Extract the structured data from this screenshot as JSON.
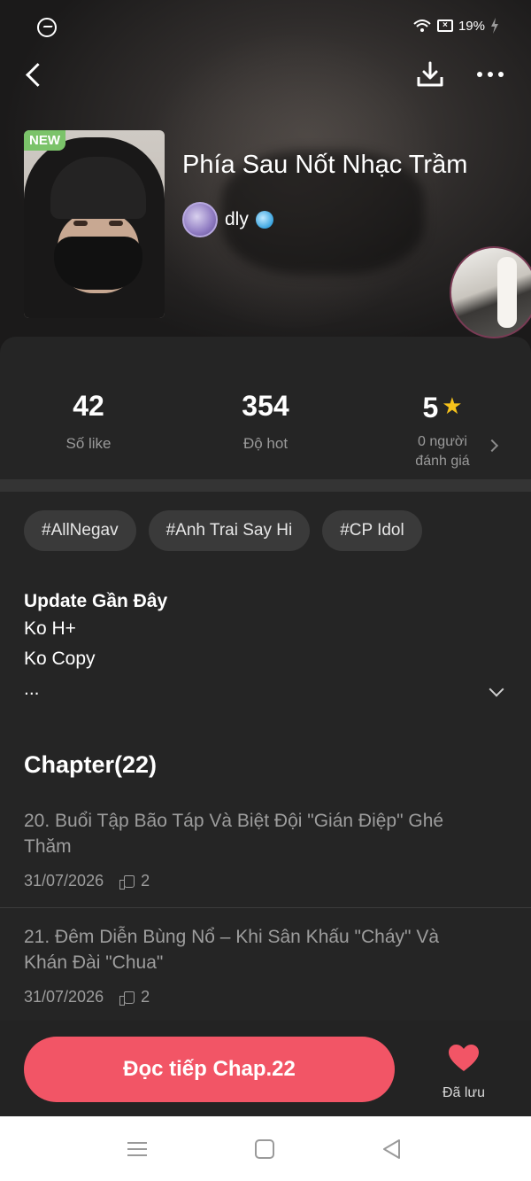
{
  "status_bar": {
    "battery": "19%"
  },
  "story": {
    "badge": "NEW",
    "title": "Phía Sau Nốt Nhạc Trầm",
    "author": "dly"
  },
  "stats": {
    "likes_value": "42",
    "likes_label": "Số like",
    "hot_value": "354",
    "hot_label": "Độ hot",
    "rating_value": "5",
    "rating_label_1": "0 người",
    "rating_label_2": "đánh giá"
  },
  "tags": [
    "#AllNegav",
    "#Anh Trai Say Hi",
    "#CP Idol"
  ],
  "description": {
    "title": "Update Gần Đây",
    "lines": [
      "Ko H+",
      "Ko Copy",
      "..."
    ]
  },
  "chapters": {
    "heading": "Chapter(22)",
    "items": [
      {
        "title": "20. Buổi Tập Bão Táp Và Biệt Đội \"Gián Điệp\" Ghé Thăm",
        "date": "31/07/2026",
        "likes": "2"
      },
      {
        "title": "21. Đêm Diễn Bùng Nổ – Khi Sân Khấu \"Cháy\" Và Khán Đài \"Chua\"",
        "date": "31/07/2026",
        "likes": "2"
      }
    ]
  },
  "actions": {
    "continue_label": "Đọc tiếp Chap.22",
    "saved_label": "Đã lưu"
  },
  "colors": {
    "accent": "#f25566",
    "star": "#f6c21b",
    "badge": "#7bc36a"
  }
}
